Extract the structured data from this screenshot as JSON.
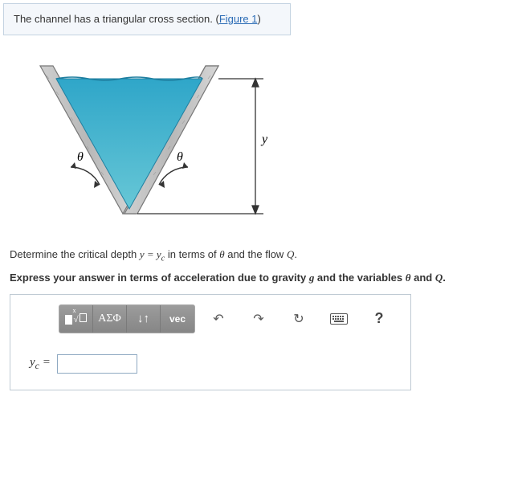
{
  "intro": {
    "text_before_link": "The channel has a triangular cross section. (",
    "link_text": "Figure 1",
    "text_after_link": ")"
  },
  "figure": {
    "theta_left": "θ",
    "theta_right": "θ",
    "depth_label": "y"
  },
  "question": {
    "line1_pre": "Determine the critical depth ",
    "line1_eq": "y = y",
    "line1_eq_sub": "c",
    "line1_post": " in terms of θ and the flow Q.",
    "line2": "Express your answer in terms of acceleration due to gravity g and the variables θ and Q."
  },
  "toolbar": {
    "template_icon_title": "templates",
    "greek_label": "ΑΣΦ",
    "subsup_title": "sub/superscript",
    "vec_label": "vec",
    "undo_title": "undo",
    "redo_title": "redo",
    "reset_title": "reset",
    "keyboard_title": "keyboard",
    "help_label": "?"
  },
  "answer": {
    "lhs_var": "y",
    "lhs_sub": "c",
    "equals": " =",
    "value": ""
  }
}
